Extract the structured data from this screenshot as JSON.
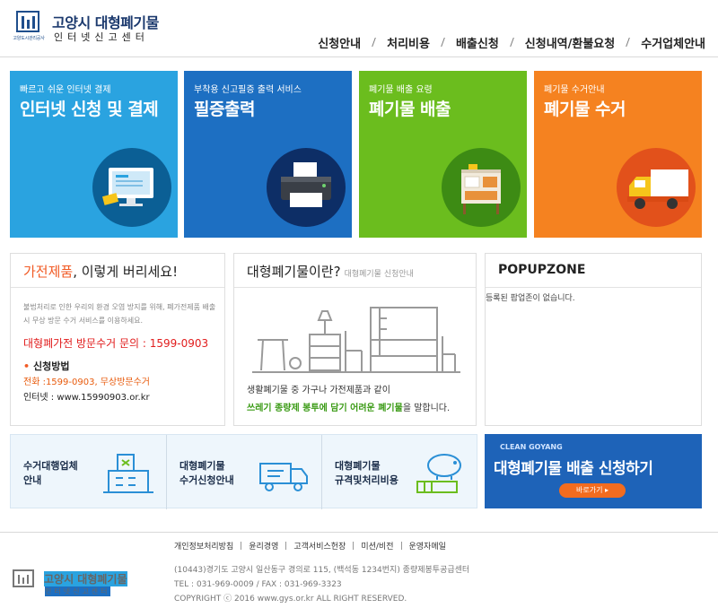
{
  "header": {
    "logo_title": "고양시 대형폐기물",
    "logo_subtitle": "인터넷신고센터",
    "logo_caption": "고양도시관리공사",
    "nav": [
      "신청안내",
      "처리비용",
      "배출신청",
      "신청내역/환불요청",
      "수거업체안내"
    ]
  },
  "tiles": [
    {
      "subtitle": "빠르고 쉬운 인터넷 결제",
      "title": "인터넷 신청 및 결제",
      "icon": "computer-icon",
      "color": "#2aa3e0"
    },
    {
      "subtitle": "부착용 신고필증 출력 서비스",
      "title": "필증출력",
      "icon": "printer-icon",
      "color": "#1d6fc2"
    },
    {
      "subtitle": "폐기물 배출 요령",
      "title": "폐기물 배출",
      "icon": "cabinet-icon",
      "color": "#6bbd1e"
    },
    {
      "subtitle": "폐기물 수거안내",
      "title": "폐기물 수거",
      "icon": "truck-icon",
      "color": "#f58220"
    }
  ],
  "appliance": {
    "title_highlight": "가전제품",
    "title_rest": ", 이렇게 버리세요!",
    "description": "불법처리로 인한 우리의 환경 오염 방지를 위해, 폐가전제품 배출시 무상 방문 수거 서비스를 이용하세요.",
    "inquiry": "대형폐가전 방문수거 문의 : 1599-0903",
    "method_label": "신청방법",
    "phone": "전화 :1599-0903, 무상방문수거",
    "web": "인터넷 : www.15990903.or.kr"
  },
  "about": {
    "title": "대형폐기물이란?",
    "title_small": "대형폐기물 신청안내",
    "text1": "생활폐기물 중 가구나 가전제품과 같이",
    "text2_highlight": "쓰레기 종량제 봉투에 담기 어려운 폐기물",
    "text2_rest": "을 말합니다."
  },
  "popup": {
    "title": "POPUPZONE",
    "empty": "등록된 팝업존이 없습니다."
  },
  "quick_links": [
    {
      "label": "수거대행업체\n안내",
      "icon": "building-icon"
    },
    {
      "label": "대형폐기물\n수거신청안내",
      "icon": "truck-icon"
    },
    {
      "label": "대형폐기물\n규격및처리비용",
      "icon": "piggybank-icon"
    }
  ],
  "banner": {
    "small": "CLEAN GOYANG",
    "big": "대형폐기물 배출 신청하기",
    "button": "바로가기 ▸"
  },
  "footer": {
    "links": [
      "개인정보처리방침",
      "윤리경영",
      "고객서비스헌장",
      "미션/비전",
      "운영자메일"
    ],
    "logo_title": "고양시 대형폐기물",
    "logo_subtitle": "인터넷신고센터",
    "address": "(10443)경기도 고양시 일산동구 경의로 115, (백석동 1234번지) 종량제봉투공급센터",
    "tel": "TEL : 031-969-0009   /   FAX : 031-969-3323",
    "copyright": "COPYRIGHT ⓒ 2016 www.gys.or.kr ALL RIGHT RESERVED."
  }
}
